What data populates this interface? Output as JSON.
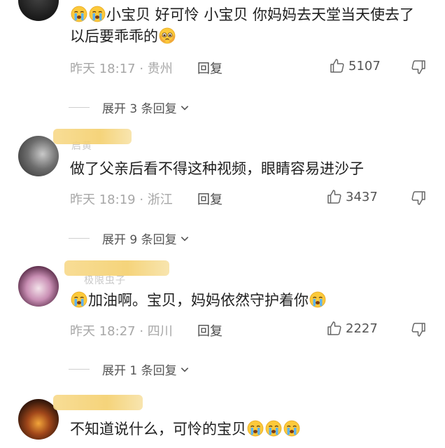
{
  "comments": [
    {
      "text_before": "小宝贝 好可怜  小宝贝 你妈妈去天堂当天使去了 以后要乖乖的",
      "time": "昨天 18:17 · 贵州",
      "reply_label": "回复",
      "likes": "5107"
    },
    {
      "name": "启黄",
      "text": "做了父亲后看不得这种视频，眼睛容易进沙子",
      "time": "昨天 18:19 · 浙江",
      "reply_label": "回复",
      "likes": "3437"
    },
    {
      "name": "极限虫子",
      "text": "加油啊。宝贝，妈妈依然守护着你",
      "time": "昨天 18:27 · 四川",
      "reply_label": "回复",
      "likes": "2227"
    },
    {
      "name": "",
      "text": "不知道说什么，可怜的宝贝",
      "time": "",
      "reply_label": "",
      "likes": ""
    }
  ],
  "expand_labels": [
    "展开 3 条回复",
    "展开 9 条回复",
    "展开 1 条回复"
  ],
  "colors": {
    "meta_gray": "#a7a7a7",
    "text": "#1f1f1f",
    "blur_yellow": "#f4cf6c"
  },
  "icons": [
    "crying-face-emoji",
    "pleading-face-emoji",
    "thumbs-up-icon",
    "thumbs-down-icon",
    "chevron-down-icon"
  ]
}
